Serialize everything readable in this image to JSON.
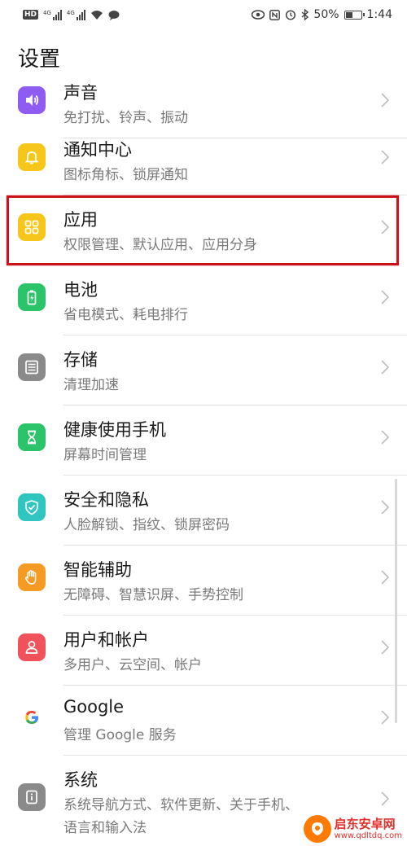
{
  "status_bar": {
    "hd": "HD",
    "net1": "4G",
    "net2": "4G",
    "battery": "50%",
    "battery_level": 0.5,
    "time": "1:44"
  },
  "header": {
    "title": "设置"
  },
  "items": [
    {
      "label": "声音",
      "sub": "免打扰、铃声、振动",
      "color": "#8e5cf2",
      "icon": "volume-icon"
    },
    {
      "label": "通知中心",
      "sub": "图标角标、锁屏通知",
      "color": "#f7c61a",
      "icon": "bell-icon"
    },
    {
      "label": "应用",
      "sub": "权限管理、默认应用、应用分身",
      "color": "#f7c61a",
      "icon": "apps-grid-icon"
    },
    {
      "label": "电池",
      "sub": "省电模式、耗电排行",
      "color": "#2bc46b",
      "icon": "battery-icon"
    },
    {
      "label": "存储",
      "sub": "清理加速",
      "color": "#8a8a8a",
      "icon": "storage-icon"
    },
    {
      "label": "健康使用手机",
      "sub": "屏幕时间管理",
      "color": "#2bc46b",
      "icon": "hourglass-icon"
    },
    {
      "label": "安全和隐私",
      "sub": "人脸解锁、指纹、锁屏密码",
      "color": "#2fc6c0",
      "icon": "shield-icon"
    },
    {
      "label": "智能辅助",
      "sub": "无障碍、智慧识屏、手势控制",
      "color": "#f59a23",
      "icon": "hand-icon"
    },
    {
      "label": "用户和帐户",
      "sub": "多用户、云空间、帐户",
      "color": "#f0525b",
      "icon": "user-icon"
    },
    {
      "label": "Google",
      "sub": "管理 Google 服务",
      "color": "#ffffff",
      "icon": "google-icon"
    },
    {
      "label": "系统",
      "sub": "系统导航方式、软件更新、关于手机、",
      "sub2": "语言和输入法",
      "color": "#8a8a8a",
      "icon": "info-icon"
    }
  ],
  "watermark": {
    "title": "启东安卓网",
    "url": "www.qdltdq.com"
  }
}
